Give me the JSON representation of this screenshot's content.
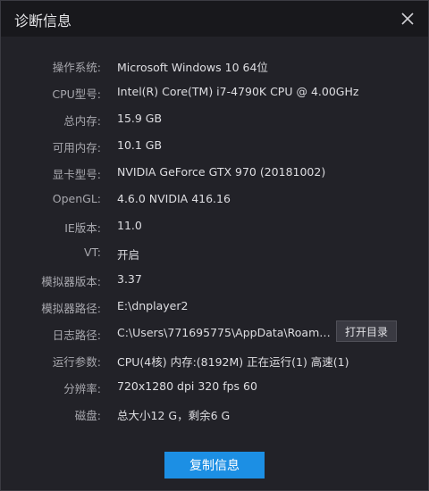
{
  "window": {
    "title": "诊断信息",
    "close_icon": "close-icon"
  },
  "info": [
    {
      "label": "操作系统:",
      "value": "Microsoft Windows 10 64位"
    },
    {
      "label": "CPU型号:",
      "value": "Intel(R) Core(TM) i7-4790K CPU @ 4.00GHz"
    },
    {
      "label": "总内存:",
      "value": "15.9 GB"
    },
    {
      "label": "可用内存:",
      "value": "10.1 GB"
    },
    {
      "label": "显卡型号:",
      "value": "NVIDIA GeForce GTX 970 (20181002)"
    },
    {
      "label": "OpenGL:",
      "value": "4.6.0 NVIDIA 416.16"
    },
    {
      "label": "IE版本:",
      "value": "11.0"
    },
    {
      "label": "VT:",
      "value": "开启"
    },
    {
      "label": "模拟器版本:",
      "value": "3.37"
    },
    {
      "label": "模拟器路径:",
      "value": "E:\\dnplayer2"
    },
    {
      "label": "日志路径:",
      "value": "C:\\Users\\771695775\\AppData\\Roaming..."
    },
    {
      "label": "运行参数:",
      "value": "CPU(4核) 内存:(8192M) 正在运行(1) 高速(1)"
    },
    {
      "label": "分辨率:",
      "value": "720x1280 dpi 320 fps 60"
    },
    {
      "label": "磁盘:",
      "value": "总大小12 G，剩余6 G"
    }
  ],
  "buttons": {
    "open_dir": "打开目录",
    "copy_info": "复制信息"
  },
  "colors": {
    "accent": "#1c8fe4",
    "background": "#222228",
    "titlebar": "#18181c"
  }
}
